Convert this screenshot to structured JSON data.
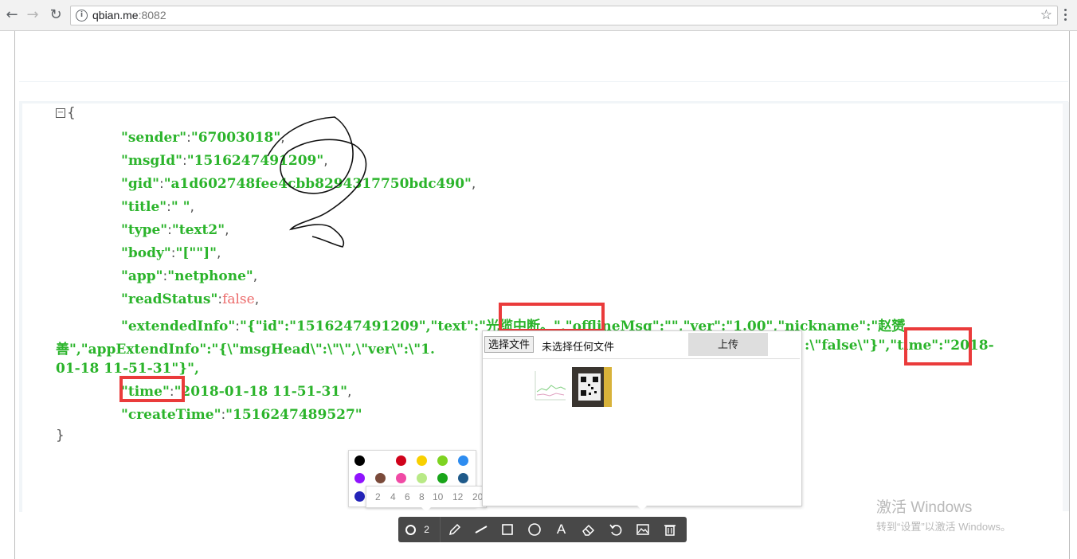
{
  "browser": {
    "url_host": "qbian.me",
    "url_port": ":8082",
    "back_icon": "back-arrow-icon",
    "forward_icon": "forward-arrow-icon",
    "reload_icon": "reload-icon"
  },
  "json_view": {
    "open_brace": "{",
    "close_brace": "}",
    "sender_key": "\"sender\"",
    "sender_val": "\"67003018\"",
    "msgid_key": "\"msgId\"",
    "msgid_val": "\"1516247491209\"",
    "gid_key": "\"gid\"",
    "gid_val": "\"a1d602748fee4cbb8294317750bdc490\"",
    "title_key": "\"title\"",
    "title_val": "\" \"",
    "type_key": "\"type\"",
    "type_val": "\"text2\"",
    "body_key": "\"body\"",
    "body_val": "\"[\"\"]\"",
    "app_key": "\"app\"",
    "app_val": "\"netphone\"",
    "readstatus_key": "\"readStatus\"",
    "readstatus_val": "false",
    "ext_key": "\"extendedInfo\"",
    "ext_line1": "\"{\"id\":\"1516247491209\",\"text\":\"光缆中断。\",\"offlineMsg\":\"\",\"ver\":\"1.00\",\"nickname\":\"赵赟",
    "ext_line2a": "善\",\"appExtendInfo\":\"{\\\"msgHead\\\":\\\"\\\",\\\"ver\\\":\\\"1.",
    "ext_line2b": ":\\\"false\\\"}\",",
    "ext_line2c": "\"time\"",
    "ext_line2d": ":\"2018-",
    "ext_line3": "01-18 11-51-31\"}\",",
    "time_key": "\"time\"",
    "time_val": "\"2018-01-18 11-51-31\"",
    "createtime_key": "\"createTime\"",
    "createtime_val": "\"1516247489527\""
  },
  "palette": {
    "colors": [
      "#000000",
      "#ffffff",
      "#d0021b",
      "#f8d000",
      "#7ed321",
      "#2d8cf0",
      "#9013fe",
      "#7a4a3a",
      "#f04aa5",
      "#b8e986",
      "#1aa51a",
      "#1f5a8a",
      "#2323b8"
    ],
    "sizes": [
      "2",
      "4",
      "6",
      "8",
      "10",
      "12",
      "20"
    ]
  },
  "upload_panel": {
    "choose_label": "选择文件",
    "no_file_label": "未选择任何文件",
    "upload_label": "上传"
  },
  "toolbar": {
    "pen_size": "2",
    "text_tool": "A",
    "icons": [
      "brush-size-icon",
      "pencil-icon",
      "line-icon",
      "rectangle-icon",
      "circle-icon",
      "text-icon",
      "eraser-icon",
      "undo-icon",
      "image-icon",
      "trash-icon"
    ]
  },
  "watermark": {
    "line1": "激活 Windows",
    "line2": "转到“设置”以激活 Windows。"
  }
}
